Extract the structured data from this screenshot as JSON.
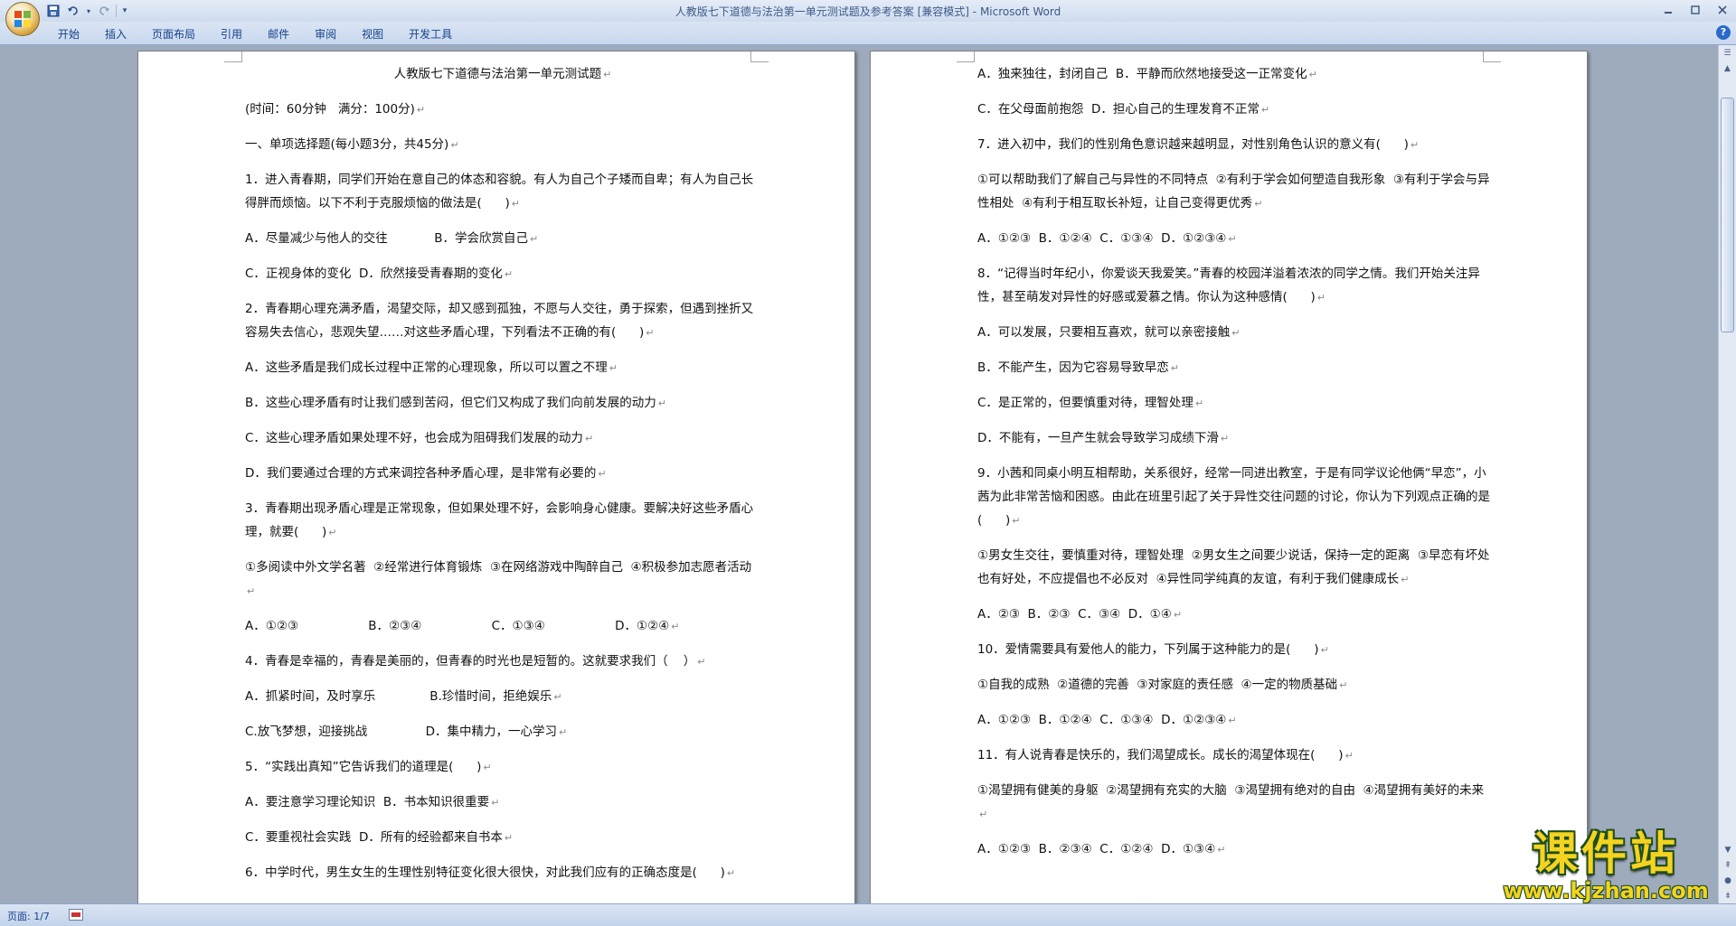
{
  "window": {
    "title": "人教版七下道德与法治第一单元测试题及参考答案 [兼容模式]",
    "app": "Microsoft Word",
    "separator": " - "
  },
  "ribbon": {
    "tabs": [
      "开始",
      "插入",
      "页面布局",
      "引用",
      "邮件",
      "审阅",
      "视图",
      "开发工具"
    ]
  },
  "statusbar": {
    "page": "页面: 1/7"
  },
  "document": {
    "page1": [
      "人教版七下道德与法治第一单元测试题",
      "(时间：60分钟   满分：100分)",
      "一、单项选择题(每小题3分，共45分)",
      "1．进入青春期，同学们开始在意自己的体态和容貌。有人为自己个子矮而自卑；有人为自己长得胖而烦恼。以下不利于克服烦恼的做法是(      )",
      "A．尽量减少与他人的交往            B．学会欣赏自己",
      "C．正视身体的变化  D．欣然接受青春期的变化",
      "2．青春期心理充满矛盾，渴望交际，却又感到孤独，不愿与人交往，勇于探索，但遇到挫折又容易失去信心，悲观失望……对这些矛盾心理，下列看法不正确的有(      )",
      "A．这些矛盾是我们成长过程中正常的心理现象，所以可以置之不理",
      "B．这些心理矛盾有时让我们感到苦闷，但它们又构成了我们向前发展的动力",
      "C．这些心理矛盾如果处理不好，也会成为阻碍我们发展的动力",
      "D．我们要通过合理的方式来调控各种矛盾心理，是非常有必要的",
      "3．青春期出现矛盾心理是正常现象，但如果处理不好，会影响身心健康。要解决好这些矛盾心理，就要(      )",
      "①多阅读中外文学名著  ②经常进行体育锻炼  ③在网络游戏中陶醉自己  ④积极参加志愿者活动",
      "A．①②③                  B．②③④                  C．①③④                  D．①②④",
      "4．青春是幸福的，青春是美丽的，但青春的时光也是短暂的。这就要求我们（    ）",
      "A．抓紧时间，及时享乐              B.珍惜时间，拒绝娱乐",
      "C.放飞梦想，迎接挑战               D．集中精力，一心学习",
      "5．“实践出真知”它告诉我们的道理是(      )",
      "A．要注意学习理论知识  B．书本知识很重要",
      "C．要重视社会实践  D．所有的经验都来自书本",
      "6．中学时代，男生女生的生理性别特征变化很大很快，对此我们应有的正确态度是(      )"
    ],
    "page2": [
      "A．独来独往，封闭自己  B．平静而欣然地接受这一正常变化",
      "C．在父母面前抱怨  D．担心自己的生理发育不正常",
      "7．进入初中，我们的性别角色意识越来越明显，对性别角色认识的意义有(      )",
      "①可以帮助我们了解自己与异性的不同特点  ②有利于学会如何塑造自我形象  ③有利于学会与异性相处  ④有利于相互取长补短，让自己变得更优秀",
      "A．①②③  B．①②④  C．①③④  D．①②③④",
      "8．“记得当时年纪小，你爱谈天我爱笑。”青春的校园洋溢着浓浓的同学之情。我们开始关注异性，甚至萌发对异性的好感或爱慕之情。你认为这种感情(      )",
      "A．可以发展，只要相互喜欢，就可以亲密接触",
      "B．不能产生，因为它容易导致早恋",
      "C．是正常的，但要慎重对待，理智处理",
      "D．不能有，一旦产生就会导致学习成绩下滑",
      "9．小茜和同桌小明互相帮助，关系很好，经常一同进出教室，于是有同学议论他俩“早恋”，小茜为此非常苦恼和困惑。由此在班里引起了关于异性交往问题的讨论，你认为下列观点正确的是(      )",
      "①男女生交往，要慎重对待，理智处理  ②男女生之间要少说话，保持一定的距离  ③早恋有坏处也有好处，不应提倡也不必反对  ④异性同学纯真的友谊，有利于我们健康成长",
      "A．②③  B．②③  C．③④  D．①④",
      "10．爱情需要具有爱他人的能力，下列属于这种能力的是(      )",
      "①自我的成熟  ②道德的完善  ③对家庭的责任感  ④一定的物质基础",
      "A．①②③  B．①②④  C．①③④  D．①②③④",
      "11．有人说青春是快乐的，我们渴望成长。成长的渴望体现在(      )",
      "①渴望拥有健美的身躯  ②渴望拥有充实的大脑  ③渴望拥有绝对的自由  ④渴望拥有美好的未来",
      "A．①②③  B．②③④  C．①②④  D．①③④"
    ]
  },
  "watermark": {
    "title": "课件站",
    "url": "www.kjzhan.com"
  },
  "colors": {
    "title_text": "#3e5a88",
    "tab_text": "#15428b",
    "workspace": "#9eabbd",
    "watermark_fill": "#f4d321",
    "watermark_stroke": "#1e4e1a"
  },
  "icons": {
    "save": "save-icon",
    "undo": "undo-icon",
    "redo": "redo-icon",
    "customize": "customize-qat-icon"
  }
}
